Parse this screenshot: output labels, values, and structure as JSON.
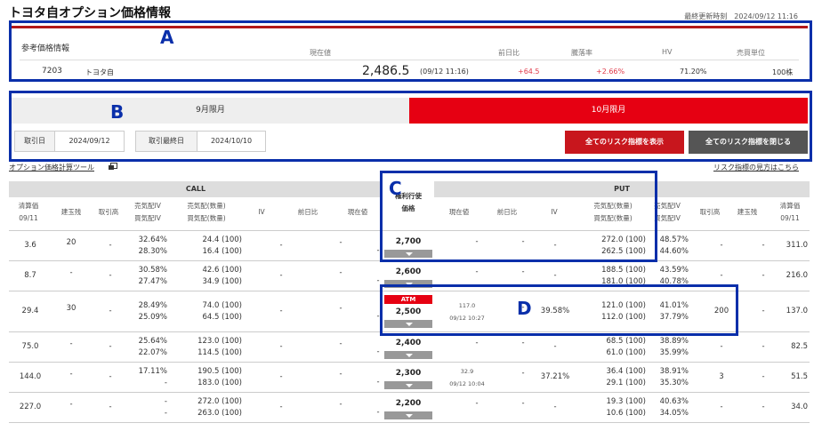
{
  "page": {
    "title": "トヨタ自オプション価格情報",
    "updated": "最終更新時刻　2024/09/12 11:16"
  },
  "annotations": {
    "a": "A",
    "b": "B",
    "c": "C",
    "d": "D"
  },
  "ref": {
    "section_label": "参考価格情報",
    "headers": {
      "current": "現在値",
      "change": "前日比",
      "rate": "騰落率",
      "hv": "HV",
      "unit": "売買単位"
    },
    "code": "7203",
    "name": "トヨタ自",
    "price": "2,486.5",
    "time": "(09/12 11:16)",
    "change": "+64.5",
    "rate": "+2.66%",
    "hv": "71.20%",
    "unit": "100株"
  },
  "tabs": {
    "sep": "9月限月",
    "oct": "10月限月"
  },
  "dates": {
    "trade_label": "取引日",
    "trade": "2024/09/12",
    "last_label": "取引最終日",
    "last": "2024/10/10"
  },
  "buttons": {
    "show_all": "全てのリスク指標を表示",
    "close_all": "全てのリスク指標を閉じる"
  },
  "links": {
    "calc_tool": "オプション価格計算ツール",
    "risk_guide": "リスク指標の見方はこちら"
  },
  "table": {
    "call_label": "CALL",
    "put_label": "PUT",
    "strike_header1": "権利行使",
    "strike_header2": "価格",
    "call_cols": [
      "清算価",
      "09/11",
      "建玉残",
      "取引高",
      "売気配IV",
      "買気配IV",
      "売気配(数量)",
      "買気配(数量)",
      "IV",
      "前日比",
      "現在値"
    ],
    "put_cols": [
      "現在値",
      "前日比",
      "IV",
      "売気配(数量)",
      "買気配(数量)",
      "売気配IV",
      "買気配IV",
      "取引高",
      "建玉残",
      "清算価",
      "09/11"
    ],
    "atm": "ATM",
    "rows": [
      {
        "strike": "2,700",
        "c_settle": "3.6",
        "c_oi": "20",
        "c_vol": "-",
        "c_ask_iv": "32.64%",
        "c_bid_iv": "28.30%",
        "c_ask": "24.4 (100)",
        "c_bid": "16.4 (100)",
        "c_iv": "-",
        "c_chg": "-",
        "c_cur": "-",
        "c_time": "",
        "p_cur": "-",
        "p_time": "",
        "p_chg": "-",
        "p_iv": "-",
        "p_ask": "272.0 (100)",
        "p_bid": "262.5 (100)",
        "p_ask_iv": "48.57%",
        "p_bid_iv": "44.60%",
        "p_vol": "-",
        "p_oi": "-",
        "p_settle": "311.0"
      },
      {
        "strike": "2,600",
        "c_settle": "8.7",
        "c_oi": "-",
        "c_vol": "-",
        "c_ask_iv": "30.58%",
        "c_bid_iv": "27.47%",
        "c_ask": "42.6 (100)",
        "c_bid": "34.9 (100)",
        "c_iv": "-",
        "c_chg": "-",
        "c_cur": "-",
        "c_time": "",
        "p_cur": "-",
        "p_time": "",
        "p_chg": "-",
        "p_iv": "-",
        "p_ask": "188.5 (100)",
        "p_bid": "181.0 (100)",
        "p_ask_iv": "43.59%",
        "p_bid_iv": "40.78%",
        "p_vol": "-",
        "p_oi": "-",
        "p_settle": "216.0"
      },
      {
        "strike": "2,500",
        "c_settle": "29.4",
        "c_oi": "30",
        "c_vol": "-",
        "c_ask_iv": "28.49%",
        "c_bid_iv": "25.09%",
        "c_ask": "74.0 (100)",
        "c_bid": "64.5 (100)",
        "c_iv": "-",
        "c_chg": "-",
        "c_cur": "-",
        "c_time": "",
        "p_cur": "117.0",
        "p_time": "09/12 10:27",
        "p_chg": "-",
        "p_iv": "39.58%",
        "p_ask": "121.0 (100)",
        "p_bid": "112.0 (100)",
        "p_ask_iv": "41.01%",
        "p_bid_iv": "37.79%",
        "p_vol": "200",
        "p_oi": "-",
        "p_settle": "137.0"
      },
      {
        "strike": "2,400",
        "c_settle": "75.0",
        "c_oi": "-",
        "c_vol": "-",
        "c_ask_iv": "25.64%",
        "c_bid_iv": "22.07%",
        "c_ask": "123.0 (100)",
        "c_bid": "114.5 (100)",
        "c_iv": "-",
        "c_chg": "-",
        "c_cur": "-",
        "c_time": "",
        "p_cur": "-",
        "p_time": "",
        "p_chg": "-",
        "p_iv": "-",
        "p_ask": "68.5 (100)",
        "p_bid": "61.0 (100)",
        "p_ask_iv": "38.89%",
        "p_bid_iv": "35.99%",
        "p_vol": "-",
        "p_oi": "-",
        "p_settle": "82.5"
      },
      {
        "strike": "2,300",
        "c_settle": "144.0",
        "c_oi": "-",
        "c_vol": "-",
        "c_ask_iv": "17.11%",
        "c_bid_iv": "-",
        "c_ask": "190.5 (100)",
        "c_bid": "183.0 (100)",
        "c_iv": "-",
        "c_chg": "-",
        "c_cur": "-",
        "c_time": "",
        "p_cur": "32.9",
        "p_time": "09/12 10:04",
        "p_chg": "-",
        "p_iv": "37.21%",
        "p_ask": "36.4 (100)",
        "p_bid": "29.1 (100)",
        "p_ask_iv": "38.91%",
        "p_bid_iv": "35.30%",
        "p_vol": "3",
        "p_oi": "-",
        "p_settle": "51.5"
      },
      {
        "strike": "2,200",
        "c_settle": "227.0",
        "c_oi": "-",
        "c_vol": "-",
        "c_ask_iv": "-",
        "c_bid_iv": "-",
        "c_ask": "272.0 (100)",
        "c_bid": "263.0 (100)",
        "c_iv": "-",
        "c_chg": "-",
        "c_cur": "-",
        "c_time": "",
        "p_cur": "-",
        "p_time": "",
        "p_chg": "-",
        "p_iv": "-",
        "p_ask": "19.3 (100)",
        "p_bid": "10.6 (100)",
        "p_ask_iv": "40.63%",
        "p_bid_iv": "34.05%",
        "p_vol": "-",
        "p_oi": "-",
        "p_settle": "34.0"
      }
    ]
  }
}
